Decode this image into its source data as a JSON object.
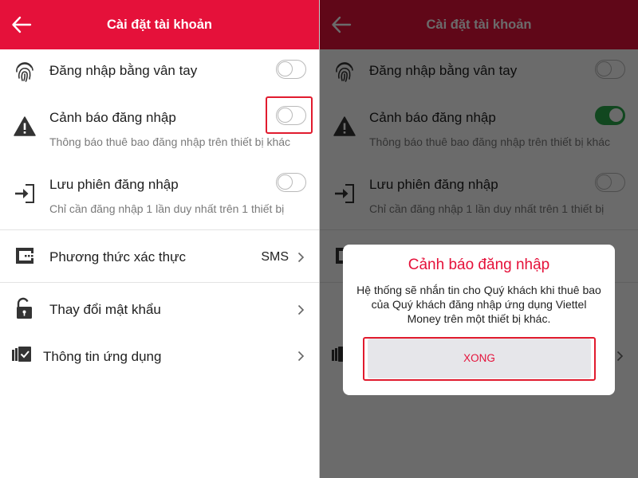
{
  "header": {
    "title": "Cài đặt tài khoản"
  },
  "settings": {
    "fingerprint": {
      "label": "Đăng nhập bằng vân tay"
    },
    "login_alert": {
      "label": "Cảnh báo đăng nhập",
      "sub": "Thông báo thuê bao đăng nhập trên thiết bị khác"
    },
    "save_session": {
      "label": "Lưu phiên đăng nhập",
      "sub": "Chỉ cần đăng nhập 1 lần duy nhất trên 1 thiết bị"
    },
    "auth_method": {
      "label": "Phương thức xác thực",
      "value": "SMS"
    },
    "change_password": {
      "label": "Thay đổi mật khẩu"
    },
    "app_info": {
      "label": "Thông tin ứng dụng"
    }
  },
  "toggle_states": {
    "left": {
      "fingerprint": false,
      "login_alert": false,
      "save_session": false
    },
    "right": {
      "fingerprint": false,
      "login_alert": true,
      "save_session": false
    }
  },
  "dialog": {
    "title": "Cảnh báo đăng nhập",
    "body": "Hệ thống sẽ nhắn tin cho Quý khách khi thuê bao của Quý khách đăng nhập ứng dụng Viettel Money trên một thiết bị khác.",
    "button": "XONG"
  },
  "colors": {
    "brand_red": "#e5113a",
    "toggle_on": "#2aa94b",
    "highlight_box": "#e11b2e"
  },
  "icons": [
    "back-arrow-icon",
    "fingerprint-icon",
    "warning-icon",
    "login-icon",
    "auth-method-icon",
    "unlock-icon",
    "app-info-icon",
    "chevron-right-icon"
  ]
}
